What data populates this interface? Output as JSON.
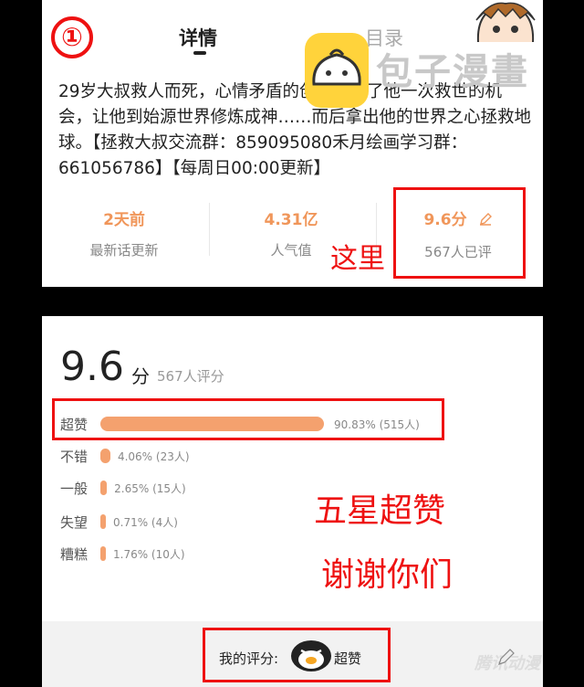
{
  "annotation_number": "①",
  "tabs": {
    "detail": "详情",
    "toc": "目录"
  },
  "watermark": {
    "brand": "包子漫畫",
    "corner": "腾讯动漫"
  },
  "description": "29岁大叔救人而死，心情矛盾的创世者给了他一次救世的机会，让他到始源世界修炼成神……而后拿出他的世界之心拯救地球。【拯救大叔交流群：859095080禾月绘画学习群：661056786】【每周日00:00更新】",
  "stats": [
    {
      "value": "2天前",
      "label": "最新话更新"
    },
    {
      "value": "4.31亿",
      "label": "人气值"
    },
    {
      "value": "9.6分",
      "label": "567人已评"
    }
  ],
  "note_here": "这里",
  "rating": {
    "score": "9.6",
    "unit": "分",
    "count_text": "567人评分",
    "rows": [
      {
        "label": "超赞",
        "fraction": 0.9083,
        "pct_text": "90.83% (515人)"
      },
      {
        "label": "不错",
        "fraction": 0.0406,
        "pct_text": "4.06% (23人)"
      },
      {
        "label": "一般",
        "fraction": 0.0265,
        "pct_text": "2.65% (15人)"
      },
      {
        "label": "失望",
        "fraction": 0.0071,
        "pct_text": "0.71% (4人)"
      },
      {
        "label": "糟糕",
        "fraction": 0.0176,
        "pct_text": "1.76% (10人)"
      }
    ]
  },
  "notes": {
    "five_star": "五星超赞",
    "thanks": "谢谢你们"
  },
  "my_rating": {
    "label": "我的评分:",
    "value": "超赞"
  },
  "colors": {
    "accent": "#f0965a",
    "bar": "#f4a16e",
    "annotation": "#e11111"
  }
}
